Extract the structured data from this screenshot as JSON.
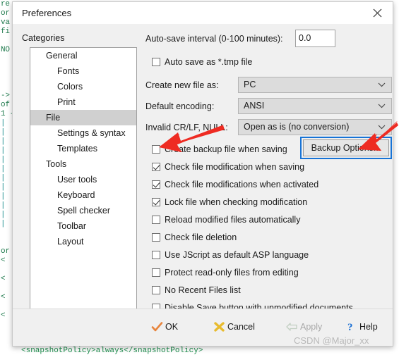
{
  "window": {
    "title": "Preferences",
    "close_icon": "close-icon"
  },
  "sidebar": {
    "label": "Categories",
    "items": [
      {
        "label": "General",
        "level": 0,
        "selected": false
      },
      {
        "label": "Fonts",
        "level": 1,
        "selected": false
      },
      {
        "label": "Colors",
        "level": 1,
        "selected": false
      },
      {
        "label": "Print",
        "level": 1,
        "selected": false
      },
      {
        "label": "File",
        "level": 0,
        "selected": true
      },
      {
        "label": "Settings & syntax",
        "level": 1,
        "selected": false
      },
      {
        "label": "Templates",
        "level": 1,
        "selected": false
      },
      {
        "label": "Tools",
        "level": 0,
        "selected": false
      },
      {
        "label": "User tools",
        "level": 1,
        "selected": false
      },
      {
        "label": "Keyboard",
        "level": 1,
        "selected": false
      },
      {
        "label": "Spell checker",
        "level": 1,
        "selected": false
      },
      {
        "label": "Toolbar",
        "level": 1,
        "selected": false
      },
      {
        "label": "Layout",
        "level": 1,
        "selected": false
      }
    ]
  },
  "form": {
    "autosave_label": "Auto-save interval (0-100 minutes):",
    "autosave_value": "0.0",
    "autosave_tmp_label": "Auto save as *.tmp file",
    "autosave_tmp_checked": false,
    "create_new_label": "Create new file as:",
    "create_new_value": "PC",
    "encoding_label": "Default encoding:",
    "encoding_value": "ANSI",
    "crlf_label": "Invalid CR/LF, NULL:",
    "crlf_value": "Open as is (no conversion)",
    "backup_button": "Backup Options...",
    "checkboxes": [
      {
        "label": "Create backup file when saving",
        "checked": false
      },
      {
        "label": "Check file modification when saving",
        "checked": true
      },
      {
        "label": "Check file modifications when activated",
        "checked": true
      },
      {
        "label": "Lock file when checking modification",
        "checked": true
      },
      {
        "label": "Reload modified files automatically",
        "checked": false
      },
      {
        "label": "Check file deletion",
        "checked": false
      },
      {
        "label": "Use JScript as default ASP language",
        "checked": false
      },
      {
        "label": "Protect read-only files from editing",
        "checked": false
      },
      {
        "label": "No Recent Files list",
        "checked": false
      },
      {
        "label": "Disable Save button with unmodified documents",
        "checked": false
      }
    ]
  },
  "footer": {
    "ok": "OK",
    "cancel": "Cancel",
    "apply": "Apply",
    "help": "Help",
    "apply_disabled": true
  },
  "annotations": {
    "watermark": "CSDN @Major_xx",
    "arrow_color": "#ee2b22",
    "highlight_color": "#1773d6"
  },
  "background": {
    "lines": [
      "re",
      "or",
      "va",
      "fi",
      "",
      "NO",
      "",
      "",
      "",
      "",
      "->",
      "of",
      "1 -",
      "|",
      "|",
      "|",
      "|",
      "|",
      "|",
      "|",
      "|",
      "|",
      "|",
      "|",
      "|",
      "",
      "",
      "or",
      "<",
      "",
      "<",
      "",
      "<",
      "",
      "<"
    ],
    "bottom_text": "<snapshotPolicy>always</snapshotPolicy>"
  }
}
